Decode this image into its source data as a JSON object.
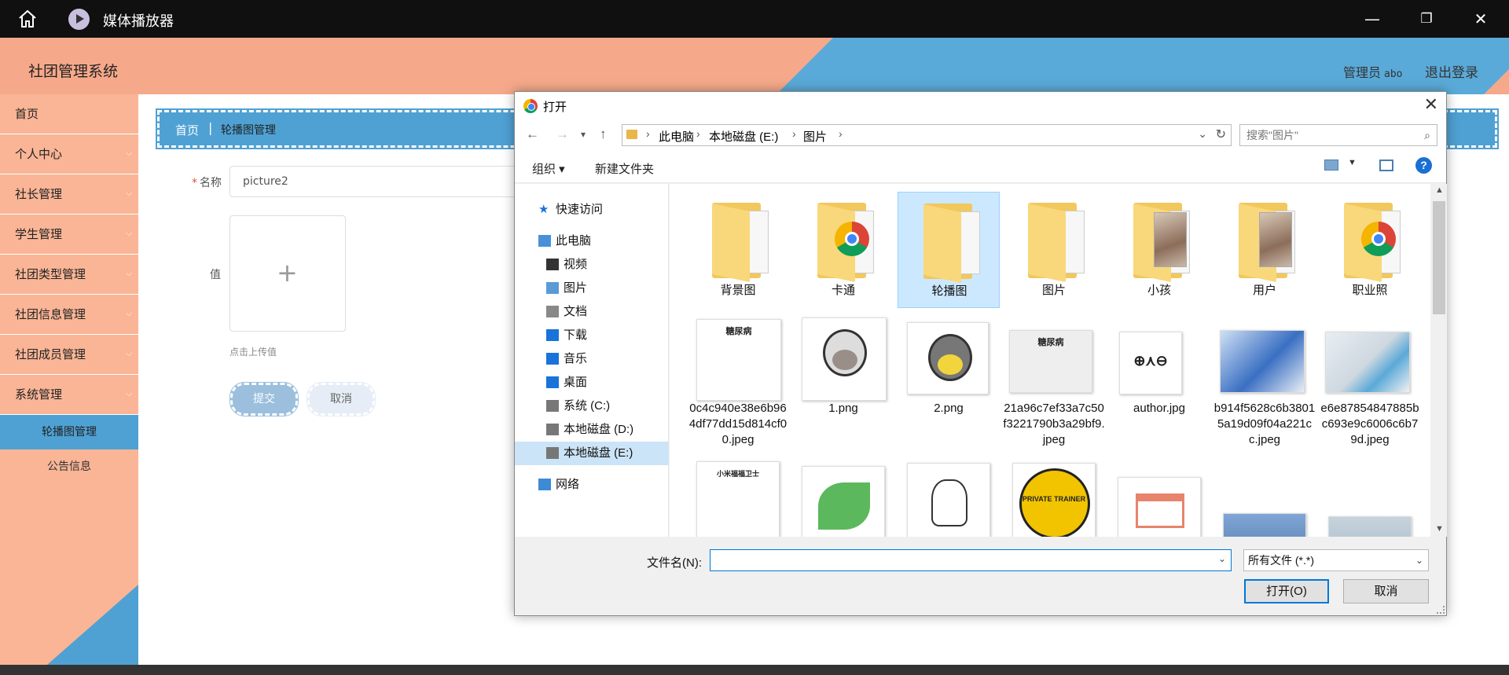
{
  "player": {
    "title": "媒体播放器",
    "min": "—",
    "restore": "❐",
    "close": "✕"
  },
  "app": {
    "title": "社团管理系统",
    "user_label": "管理员",
    "user_name": "abo",
    "logout": "退出登录",
    "colors": {
      "peach": "#f6a98a",
      "blue": "#4fa1d3"
    }
  },
  "sidebar": {
    "items": [
      {
        "label": "首页",
        "has_arrow": false
      },
      {
        "label": "个人中心",
        "has_arrow": true
      },
      {
        "label": "社长管理",
        "has_arrow": true
      },
      {
        "label": "学生管理",
        "has_arrow": true
      },
      {
        "label": "社团类型管理",
        "has_arrow": true
      },
      {
        "label": "社团信息管理",
        "has_arrow": true
      },
      {
        "label": "社团成员管理",
        "has_arrow": true
      },
      {
        "label": "系统管理",
        "has_arrow": true
      }
    ],
    "submenu": [
      {
        "label": "轮播图管理",
        "active": true
      },
      {
        "label": "公告信息",
        "active": false
      }
    ]
  },
  "breadcrumb": {
    "home": "首页",
    "separator": "|",
    "current": "轮播图管理"
  },
  "form": {
    "name_label": "名称",
    "name_value": "picture2",
    "value_label": "值",
    "upload_plus": "+",
    "upload_hint": "点击上传值",
    "submit": "提交",
    "cancel": "取消"
  },
  "dialog": {
    "title": "打开",
    "close": "✕",
    "path": [
      "此电脑",
      "本地磁盘 (E:)",
      "图片"
    ],
    "search_placeholder": "搜索\"图片\"",
    "organize": "组织 ▾",
    "new_folder": "新建文件夹",
    "help": "?",
    "nav": [
      {
        "label": "快速访问",
        "icon": "star-icon"
      },
      {
        "label": "此电脑",
        "icon": "computer-icon"
      },
      {
        "label": "视频",
        "icon": "video-icon"
      },
      {
        "label": "图片",
        "icon": "pictures-icon"
      },
      {
        "label": "文档",
        "icon": "document-icon"
      },
      {
        "label": "下载",
        "icon": "download-icon"
      },
      {
        "label": "音乐",
        "icon": "music-icon"
      },
      {
        "label": "桌面",
        "icon": "desktop-icon"
      },
      {
        "label": "系统 (C:)",
        "icon": "drive-icon"
      },
      {
        "label": "本地磁盘 (D:)",
        "icon": "drive-icon"
      },
      {
        "label": "本地磁盘 (E:)",
        "icon": "drive-icon",
        "selected": true
      },
      {
        "label": "网络",
        "icon": "network-icon"
      }
    ],
    "folders": [
      {
        "name": "背景图",
        "overlay": ""
      },
      {
        "name": "卡通",
        "overlay": "chrome"
      },
      {
        "name": "轮播图",
        "overlay": "",
        "selected": true
      },
      {
        "name": "图片",
        "overlay": ""
      },
      {
        "name": "小孩",
        "overlay": "photo"
      },
      {
        "name": "用户",
        "overlay": "photo"
      },
      {
        "name": "职业照",
        "overlay": "chrome"
      }
    ],
    "files": [
      {
        "name": "0c4c940e38e6b964df77dd15d814cf00.jpeg",
        "thumb_text": "糖尿病"
      },
      {
        "name": "1.png",
        "thumb_text": ""
      },
      {
        "name": "2.png",
        "thumb_text": ""
      },
      {
        "name": "21a96c7ef33a7c50f3221790b3a29bf9.jpeg",
        "thumb_text": "糖尿病"
      },
      {
        "name": "author.jpg",
        "thumb_text": "⊕⋏⊖"
      },
      {
        "name": "b914f5628c6b38015a19d09f04a221cc.jpeg",
        "thumb_text": ""
      },
      {
        "name": "e6e87854847885bc693e9c6006c6b79d.jpeg",
        "thumb_text": ""
      }
    ],
    "partial_row": [
      {
        "thumb_text": "小米福福卫士"
      },
      {
        "thumb_text": ""
      },
      {
        "thumb_text": ""
      },
      {
        "thumb_text": "PRIVATE TRAINER"
      },
      {
        "thumb_text": ""
      },
      {
        "thumb_text": ""
      },
      {
        "thumb_text": ""
      }
    ],
    "filename_label": "文件名(N):",
    "filename_value": "",
    "filetype": "所有文件 (*.*)",
    "open": "打开(O)",
    "cancel": "取消"
  }
}
